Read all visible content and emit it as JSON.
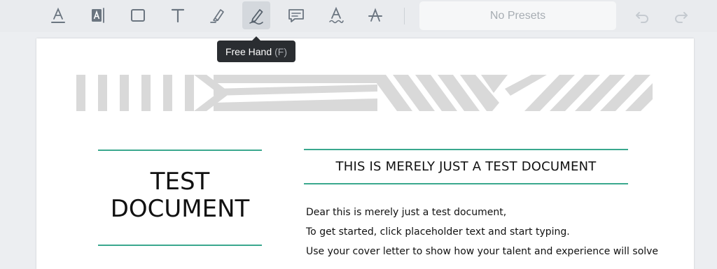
{
  "toolbar": {
    "tools": [
      {
        "name": "Underline",
        "icon": "underline-text-icon"
      },
      {
        "name": "Highlight Text",
        "icon": "highlight-text-icon"
      },
      {
        "name": "Rectangle",
        "icon": "rectangle-icon"
      },
      {
        "name": "Free Text",
        "icon": "text-icon"
      },
      {
        "name": "Highlight",
        "icon": "highlighter-icon"
      },
      {
        "name": "Free Hand",
        "icon": "pen-icon",
        "active": true
      },
      {
        "name": "Comment",
        "icon": "comment-icon"
      },
      {
        "name": "Squiggly",
        "icon": "squiggly-text-icon"
      },
      {
        "name": "Strikeout",
        "icon": "strikeout-text-icon"
      }
    ],
    "presets_label": "No Presets",
    "undo_icon": "undo-icon",
    "redo_icon": "redo-icon"
  },
  "tooltip": {
    "label": "Free Hand",
    "shortcut": "(F)"
  },
  "document": {
    "title_line1": "TEST",
    "title_line2": "DOCUMENT",
    "heading": "THIS IS MERELY JUST A TEST DOCUMENT",
    "body": [
      "Dear this is merely just a test document,",
      "To get started, click placeholder text and start typing.",
      "Use your cover letter to show how your talent and experience will solve"
    ]
  },
  "colors": {
    "accent_rule": "#3aa88e",
    "banner_stripes": "#d9d9d9",
    "toolbar_bg": "#e9ebee",
    "active_tool_bg": "#d4d8dd",
    "icon": "#6b7580"
  }
}
